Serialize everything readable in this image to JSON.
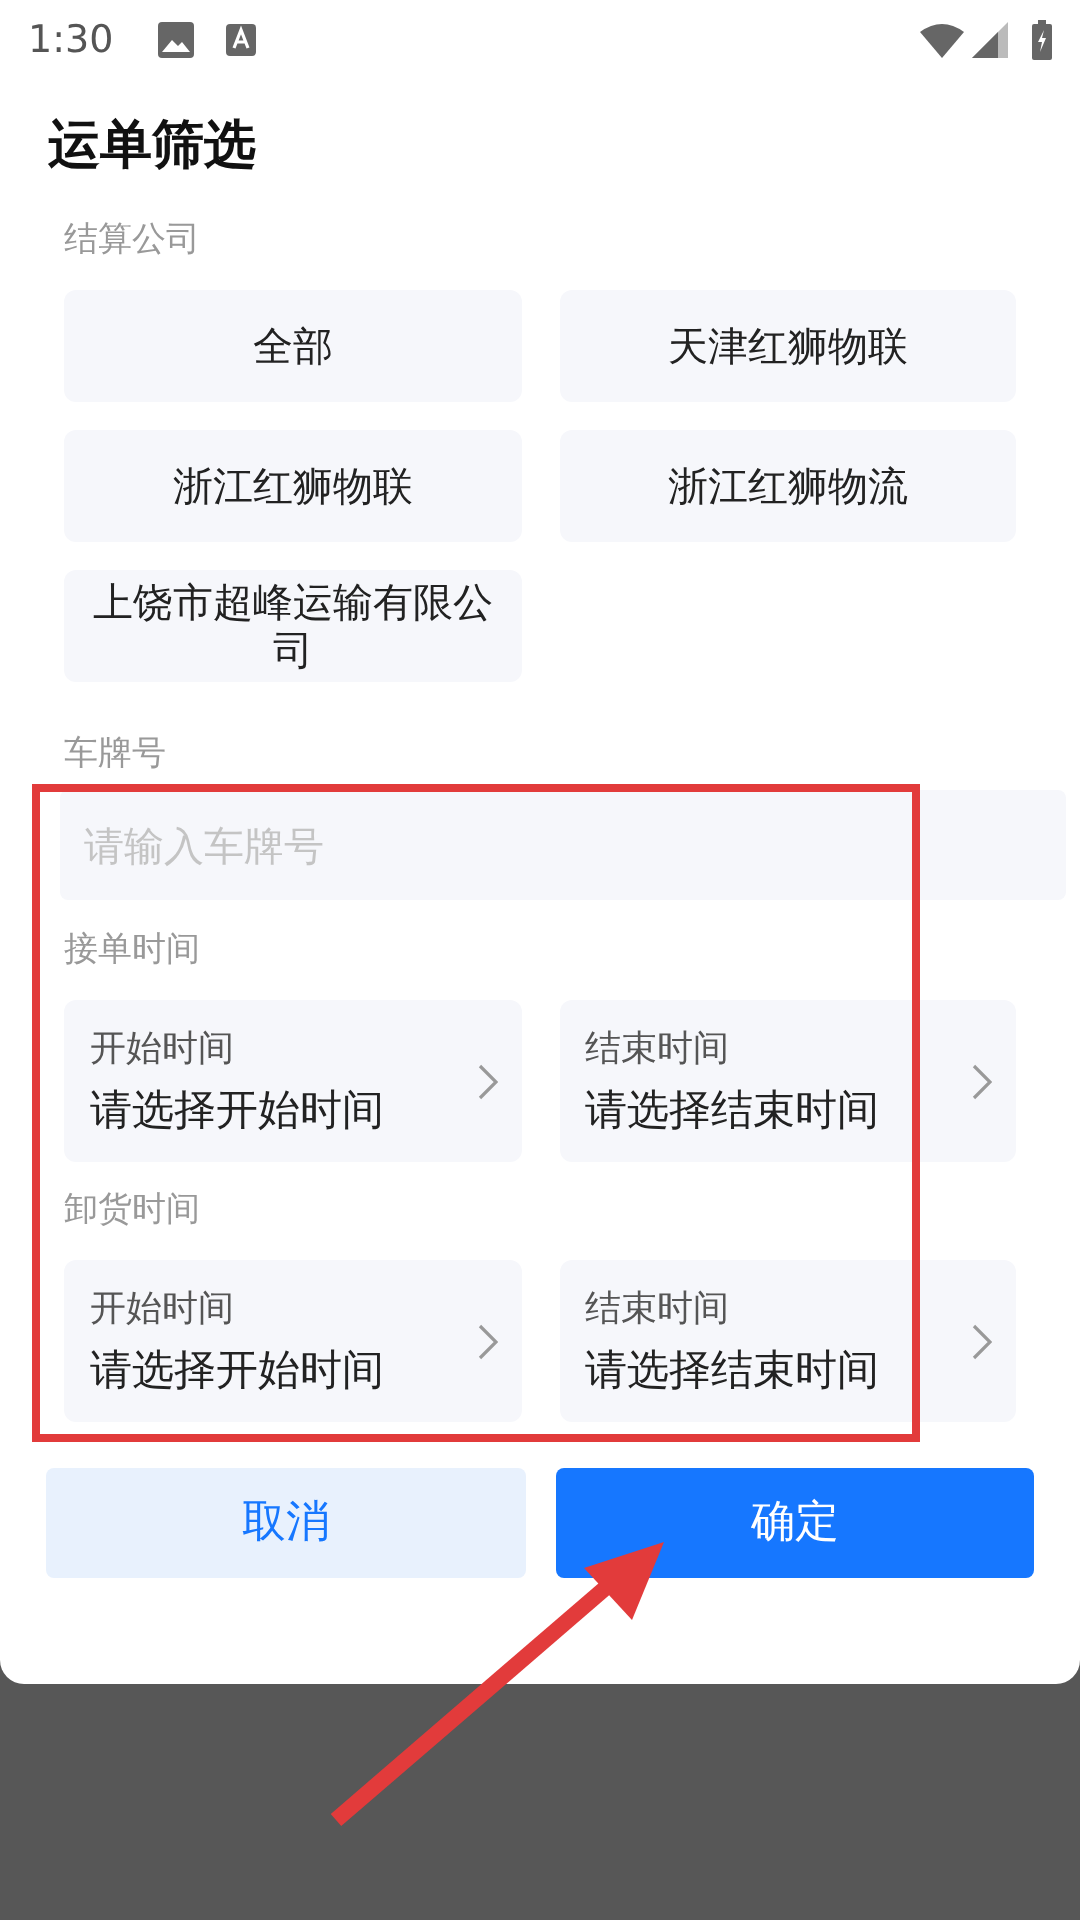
{
  "status_bar": {
    "time": "1:30"
  },
  "title": "运单筛选",
  "company_section": {
    "label": "结算公司",
    "options": [
      {
        "label": "全部"
      },
      {
        "label": "天津红狮物联"
      },
      {
        "label": "浙江红狮物联"
      },
      {
        "label": "浙江红狮物流"
      },
      {
        "label": "上饶市超峰运输有限公司"
      }
    ]
  },
  "plate_section": {
    "label": "车牌号",
    "placeholder": "请输入车牌号"
  },
  "time_sections": [
    {
      "label": "接单时间",
      "pickers": [
        {
          "label": "开始时间",
          "placeholder": "请选择开始时间"
        },
        {
          "label": "结束时间",
          "placeholder": "请选择结束时间"
        }
      ]
    },
    {
      "label": "卸货时间",
      "pickers": [
        {
          "label": "开始时间",
          "placeholder": "请选择开始时间"
        },
        {
          "label": "结束时间",
          "placeholder": "请选择结束时间"
        }
      ]
    }
  ],
  "buttons": [
    {
      "label": "取消",
      "kind": "secondary"
    },
    {
      "label": "确定",
      "kind": "primary"
    }
  ]
}
